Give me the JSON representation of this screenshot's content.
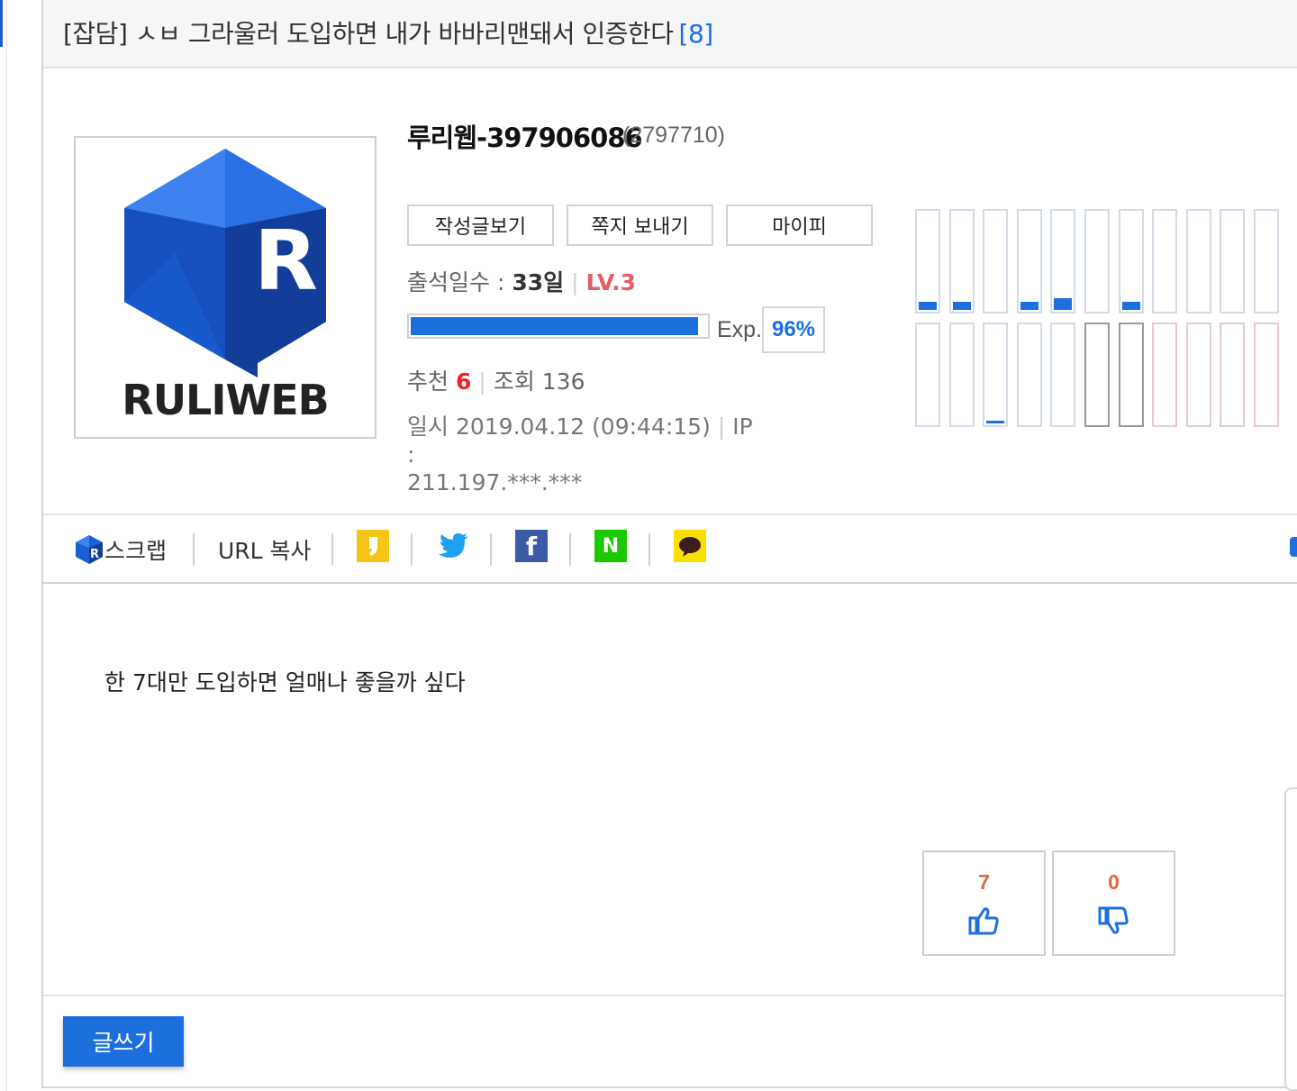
{
  "post": {
    "category": "[잡담]",
    "title": "ㅅㅂ 그라울러 도입하면 내가 바바리맨돼서 인증한다",
    "comment_count": "[8]",
    "body": "한 7대만 도입하면 얼매나 좋을까 싶다"
  },
  "author": {
    "logo_text": "RULIWEB",
    "nickname": "루리웹-397906086",
    "user_id": "(2797710)",
    "buttons": {
      "posts": "작성글보기",
      "message": "쪽지 보내기",
      "mypi": "마이피"
    },
    "attendance_label": "출석일수 :",
    "attendance_value": "33일",
    "level": "LV.3",
    "exp_label": "Exp.",
    "exp_percent": "96%",
    "exp_fraction": 0.96,
    "recommend_label": "추천",
    "recommend_value": "6",
    "views_label": "조회",
    "views_value": "136",
    "date_text": "일시 2019.04.12 (09:44:15)",
    "ip_label": "IP :",
    "ip_value": "211.197.***.***"
  },
  "activity_gauges": {
    "top_row": [
      0.08,
      0.08,
      0,
      0.08,
      0.12,
      0,
      0.08,
      0,
      0,
      0,
      0
    ],
    "bottom_row": [
      0,
      0,
      0.03,
      0,
      0,
      0,
      0,
      0,
      0,
      0,
      0
    ],
    "bottom_row_style": [
      "normal",
      "normal",
      "normal",
      "normal",
      "normal",
      "grey",
      "grey",
      "pink",
      "pink",
      "pink",
      "pink"
    ]
  },
  "share": {
    "scrap_label": "스크랩",
    "url_copy_label": "URL 복사",
    "icons": [
      "kakaostory-icon",
      "twitter-icon",
      "facebook-icon",
      "naver-icon",
      "kakaotalk-icon"
    ]
  },
  "votes": {
    "up": "7",
    "down": "0"
  },
  "write_button": "글쓰기",
  "colors": {
    "accent": "#1e6fde",
    "level": "#e35e67",
    "recommend": "#ee2222",
    "vote": "#e0663e"
  }
}
